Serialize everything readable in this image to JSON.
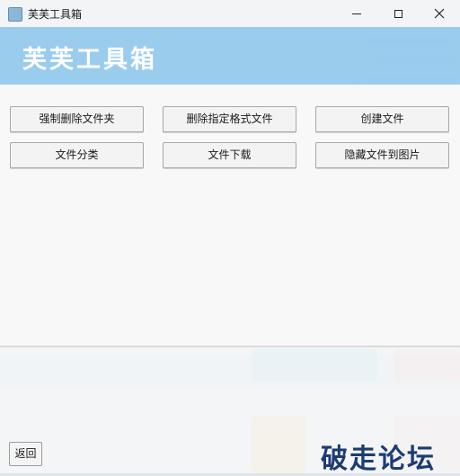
{
  "window": {
    "title": "芙芙工具箱"
  },
  "banner": {
    "title": "芙芙工具箱"
  },
  "buttons": {
    "force_delete_folder": "强制删除文件夹",
    "delete_by_format": "删除指定格式文件",
    "create_file": "创建文件",
    "file_classify": "文件分类",
    "file_download": "文件下载",
    "hide_file_in_image": "隐藏文件到图片"
  },
  "footer": {
    "back_label": "返回"
  },
  "watermark": {
    "text": "破走论坛"
  },
  "icons": [
    "app-icon",
    "minimize-icon",
    "maximize-icon",
    "close-icon"
  ],
  "colors": {
    "banner": "#8ac4ec",
    "banner_text": "#ffffff",
    "watermark": "#1d3c73"
  }
}
